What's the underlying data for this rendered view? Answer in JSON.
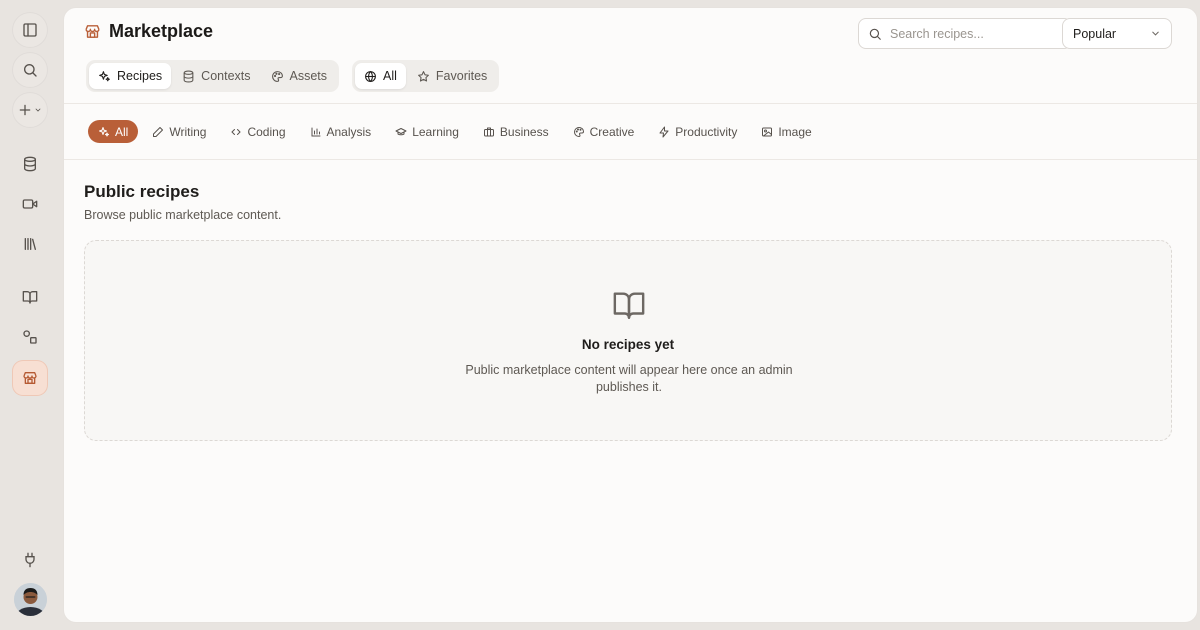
{
  "app": {
    "title": "Marketplace"
  },
  "search": {
    "placeholder": "Search recipes..."
  },
  "sort": {
    "selected": "Popular"
  },
  "type_tabs": [
    {
      "label": "Recipes",
      "icon": "sparkles-icon",
      "active": true
    },
    {
      "label": "Contexts",
      "icon": "database-icon",
      "active": false
    },
    {
      "label": "Assets",
      "icon": "palette-icon",
      "active": false
    }
  ],
  "scope_tabs": [
    {
      "label": "All",
      "icon": "globe-icon",
      "active": true
    },
    {
      "label": "Favorites",
      "icon": "star-icon",
      "active": false
    }
  ],
  "categories": [
    {
      "label": "All",
      "icon": "sparkles-icon",
      "active": true
    },
    {
      "label": "Writing",
      "icon": "pencil-icon"
    },
    {
      "label": "Coding",
      "icon": "code-icon"
    },
    {
      "label": "Analysis",
      "icon": "bar-chart-icon"
    },
    {
      "label": "Learning",
      "icon": "graduation-cap-icon"
    },
    {
      "label": "Business",
      "icon": "briefcase-icon"
    },
    {
      "label": "Creative",
      "icon": "palette-icon"
    },
    {
      "label": "Productivity",
      "icon": "zap-icon"
    },
    {
      "label": "Image",
      "icon": "image-icon"
    }
  ],
  "section": {
    "title": "Public recipes",
    "subtitle": "Browse public marketplace content."
  },
  "empty_state": {
    "icon": "open-book-icon",
    "heading": "No recipes yet",
    "message": "Public marketplace content will appear here once an admin publishes it."
  },
  "sidebar": {
    "items": [
      {
        "name": "toggle-sidebar",
        "icon": "sidebar-toggle-icon"
      },
      {
        "name": "search",
        "icon": "search-icon"
      },
      {
        "name": "new",
        "icon": "plus-icon"
      },
      {
        "name": "contexts",
        "icon": "database-icon"
      },
      {
        "name": "video",
        "icon": "video-icon"
      },
      {
        "name": "library",
        "icon": "library-icon"
      },
      {
        "name": "docs",
        "icon": "book-icon"
      },
      {
        "name": "workflows",
        "icon": "shapes-icon"
      },
      {
        "name": "marketplace",
        "icon": "store-icon",
        "active": true
      },
      {
        "name": "integrations",
        "icon": "plug-icon"
      }
    ]
  },
  "colors": {
    "accent": "#b95f38",
    "accent_soft": "#f7dfd3",
    "background": "#e8e4e0",
    "panel": "#fcfbfa"
  }
}
